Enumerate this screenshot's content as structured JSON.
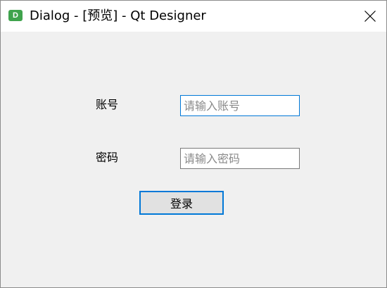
{
  "window": {
    "icon_letter": "D",
    "title": "Dialog - [预览] - Qt Designer"
  },
  "form": {
    "account": {
      "label": "账号",
      "placeholder": "请输入账号",
      "value": ""
    },
    "password": {
      "label": "密码",
      "placeholder": "请输入密码",
      "value": ""
    },
    "login_button_label": "登录"
  },
  "colors": {
    "focus_accent": "#0078d7",
    "app_icon": "#3fa34d",
    "dialog_background": "#f0f0f0"
  }
}
